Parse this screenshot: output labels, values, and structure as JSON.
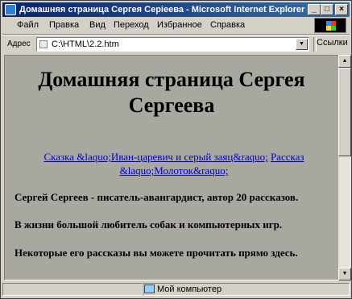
{
  "window": {
    "title": "Домашняя страница Сергея Серiеева - Microsoft Internet Explorer",
    "minimize_label": "_",
    "maximize_label": "□",
    "close_label": "×"
  },
  "menu": {
    "items": [
      "Файл",
      "Правка",
      "Вид",
      "Переход",
      "Избранное",
      "Справка"
    ]
  },
  "address": {
    "label": "Адрес",
    "value": "C:\\HTML\\2.2.htm",
    "links_label": "Ссылки"
  },
  "page": {
    "heading_line1": "Домашняя страница Сергея",
    "heading_line2": "Сергеева",
    "link1": "Сказка &laquo;Иван-царевич и серый заяц&raquo;",
    "link_sep": "  ",
    "link2": "Рассказ &laquo;Молоток&raquo;",
    "para1": "Сергей Сергеев - писатель-авангардист, автор 20 рассказов.",
    "para2": "В жизни большой любитель собак и компьютерных игр.",
    "para3": "Некоторые его рассказы вы можете прочитать прямо здесь."
  },
  "status": {
    "zone": "Мой компьютер"
  },
  "colors": {
    "titlebar": "#0a246a",
    "page_background": "#a8a8a0",
    "link": "#0000cc"
  },
  "icons": [
    "ie-page-icon",
    "windows-logo-icon",
    "address-page-icon",
    "my-computer-icon"
  ]
}
